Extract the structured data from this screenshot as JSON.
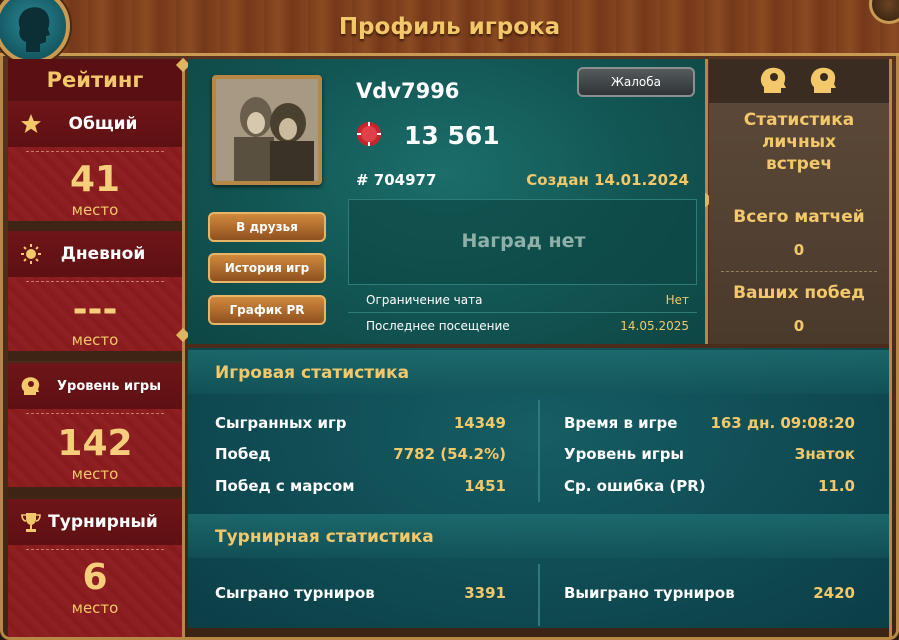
{
  "header": {
    "title": "Профиль игрока"
  },
  "rating": {
    "title": "Рейтинг",
    "items": [
      {
        "label": "Общий",
        "value": "41",
        "unit": "место",
        "icon": "star-icon"
      },
      {
        "label": "Дневной",
        "value": "---",
        "unit": "место",
        "icon": "sun-icon"
      },
      {
        "label": "Уровень игры",
        "value": "142",
        "unit": "место",
        "icon": "head-gear-icon"
      },
      {
        "label": "Турнирный",
        "value": "6",
        "unit": "место",
        "icon": "trophy-icon"
      }
    ]
  },
  "profile": {
    "nickname": "Vdv7996",
    "rating": "13 561",
    "id": "# 704977",
    "created": "Создан 14.01.2024",
    "complaint_label": "Жалоба",
    "buttons": {
      "add_friend": "В друзья",
      "game_history": "История игр",
      "pr_chart": "График PR"
    },
    "awards_text": "Наград нет",
    "chat_limit_label": "Ограничение чата",
    "chat_limit_value": "Нет",
    "last_visit_label": "Последнее посещение",
    "last_visit_value": "14.05.2025"
  },
  "h2h": {
    "title": "Статистика личных встреч",
    "total_label": "Всего матчей",
    "total_value": "0",
    "wins_label": "Ваших побед",
    "wins_value": "0"
  },
  "game_stats": {
    "title": "Игровая статистика",
    "left": [
      {
        "label": "Сыгранных игр",
        "value": "14349"
      },
      {
        "label": "Побед",
        "value": "7782 (54.2%)"
      },
      {
        "label": "Побед с марсом",
        "value": "1451"
      }
    ],
    "right": [
      {
        "label": "Время в игре",
        "value": "163 дн. 09:08:20"
      },
      {
        "label": "Уровень игры",
        "value": "Знаток"
      },
      {
        "label": "Ср. ошибка (PR)",
        "value": "11.0"
      }
    ]
  },
  "tournament_stats": {
    "title": "Турнирная статистика",
    "played_label": "Сыграно турниров",
    "played_value": "3391",
    "won_label": "Выиграно турниров",
    "won_value": "2420"
  },
  "colors": {
    "accent_gold": "#f2c86a",
    "rating_red": "#8a1c1f",
    "teal": "#125553",
    "frame_gold": "#b78745"
  }
}
